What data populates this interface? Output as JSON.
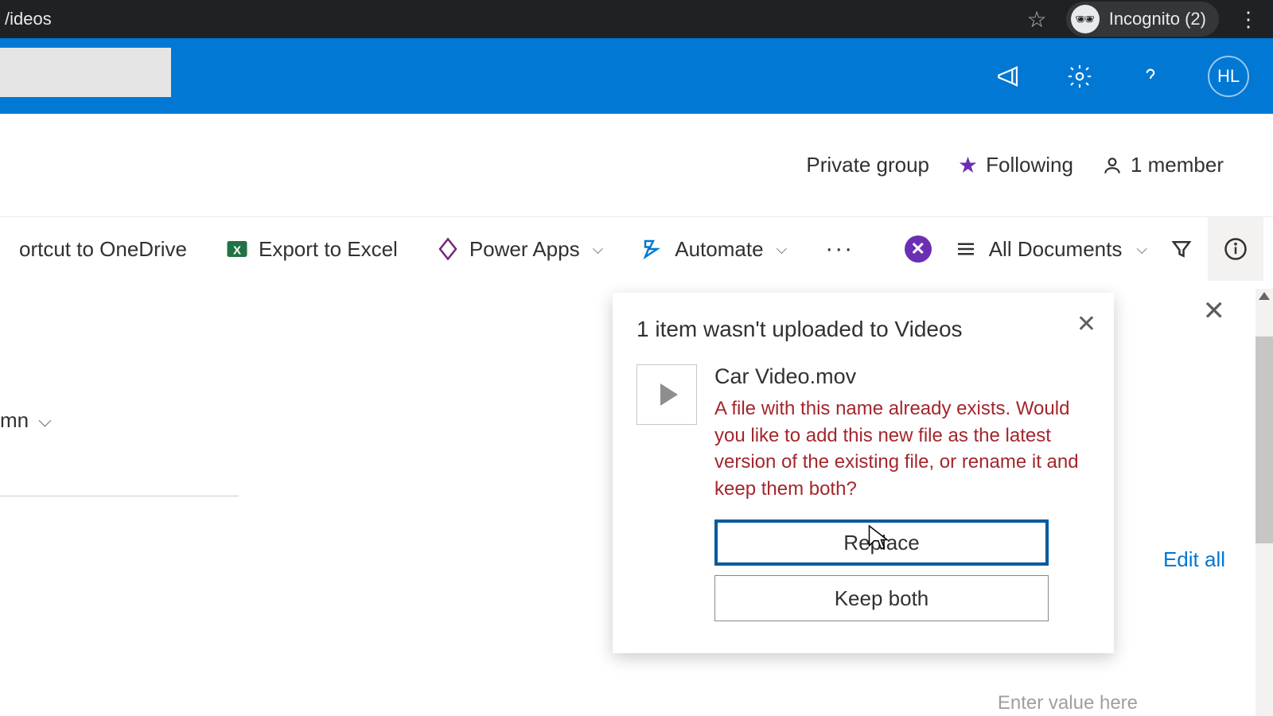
{
  "browser": {
    "address_fragment": "/ideos",
    "incognito_label": "Incognito (2)"
  },
  "suite": {
    "avatar_initials": "HL"
  },
  "group": {
    "privacy": "Private group",
    "follow_label": "Following",
    "members_label": "1 member"
  },
  "commands": {
    "shortcut": "ortcut to OneDrive",
    "export": "Export to Excel",
    "powerapps": "Power Apps",
    "automate": "Automate",
    "view_label": "All Documents"
  },
  "list": {
    "column_fragment": "mn"
  },
  "callout": {
    "title": "1 item wasn't uploaded to Videos",
    "file_name": "Car Video.mov",
    "message": "A file with this name already exists. Would you like to add this new file as the latest version of the existing file, or rename it and keep them both?",
    "replace_label": "Replace",
    "keep_both_label": "Keep both"
  },
  "details": {
    "edit_all": "Edit all",
    "placeholder": "Enter value here"
  }
}
